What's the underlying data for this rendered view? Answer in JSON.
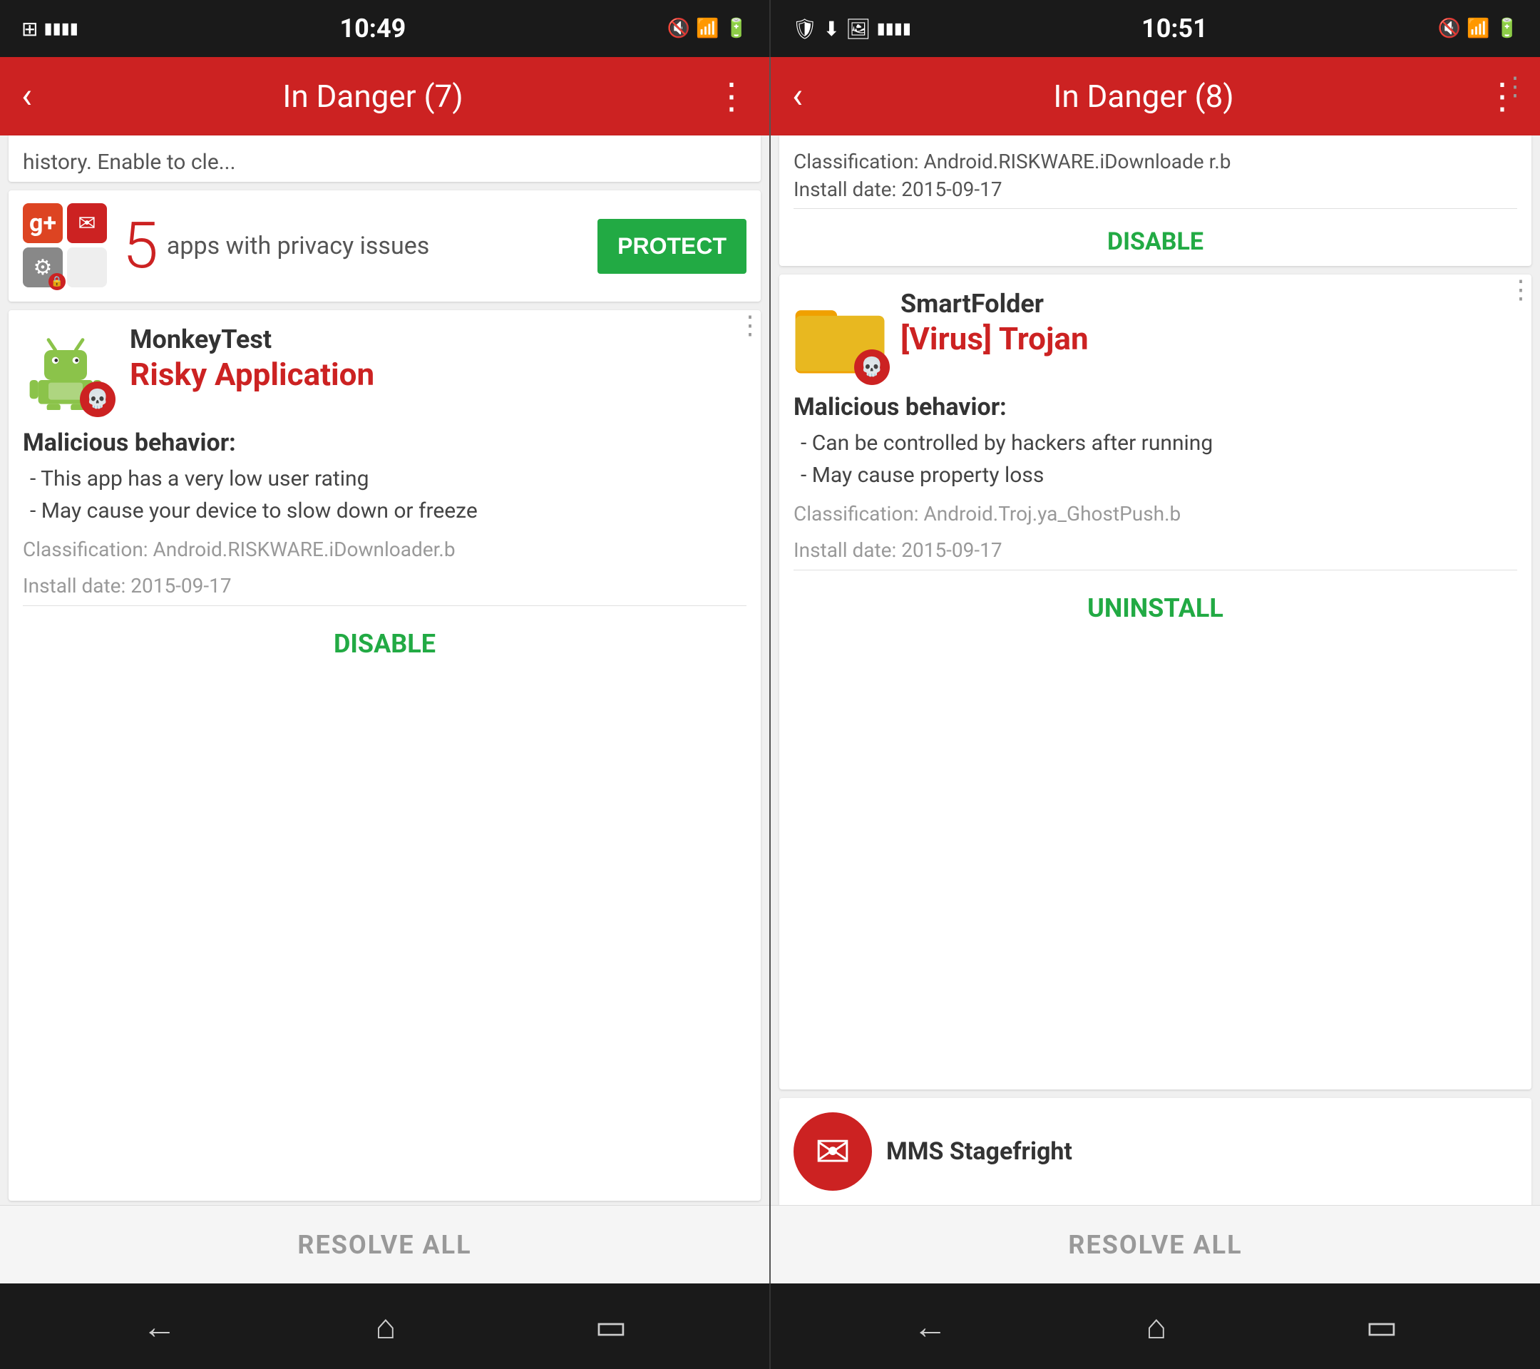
{
  "panels": [
    {
      "id": "left",
      "statusBar": {
        "icons_left": "⊞ ≡≡≡",
        "time": "10:49",
        "icons_right": "🔇 📶 🔋"
      },
      "header": {
        "back_label": "‹",
        "title": "In Danger (7)",
        "menu_label": "⋮"
      },
      "partialCard": {
        "text": "history. Enable to cle..."
      },
      "privacyCard": {
        "count": "5",
        "description": "apps with privacy issues",
        "buttonLabel": "PROTECT"
      },
      "threatCard": {
        "appName": "MonkeyTest",
        "threatStatus": "Risky Application",
        "behaviorTitle": "Malicious behavior:",
        "behaviors": [
          "- This app has a very low user rating",
          "- May cause your device to slow down or freeze"
        ],
        "classification": "Classification: Android.RISKWARE.iDownloader.b",
        "installDate": "Install date: 2015-09-17",
        "actionLabel": "DISABLE"
      },
      "resolveAll": "RESOLVE ALL"
    },
    {
      "id": "right",
      "statusBar": {
        "icons_left": "🛡 ⬇ 🖼 ≡≡≡",
        "time": "10:51",
        "icons_right": "🔇 📶 🔋"
      },
      "header": {
        "back_label": "‹",
        "title": "In Danger (8)",
        "menu_label": "⋮"
      },
      "partialCard": {
        "classification": "Classification: Android.RISKWARE.iDownloade r.b",
        "installDate": "Install date: 2015-09-17",
        "actionLabel": "DISABLE"
      },
      "threatCard": {
        "appName": "SmartFolder",
        "threatStatus": "[Virus] Trojan",
        "behaviorTitle": "Malicious behavior:",
        "behaviors": [
          "- Can be controlled by hackers after running",
          "- May cause property loss"
        ],
        "classification": "Classification: Android.Troj.ya_GhostPush.b",
        "installDate": "Install date: 2015-09-17",
        "actionLabel": "UNINSTALL"
      },
      "partialBottomCard": {
        "appName": "MMS Stagefright"
      },
      "resolveAll": "RESOLVE ALL"
    }
  ],
  "navButtons": {
    "back": "←",
    "home": "⌂",
    "recent": "▭"
  }
}
